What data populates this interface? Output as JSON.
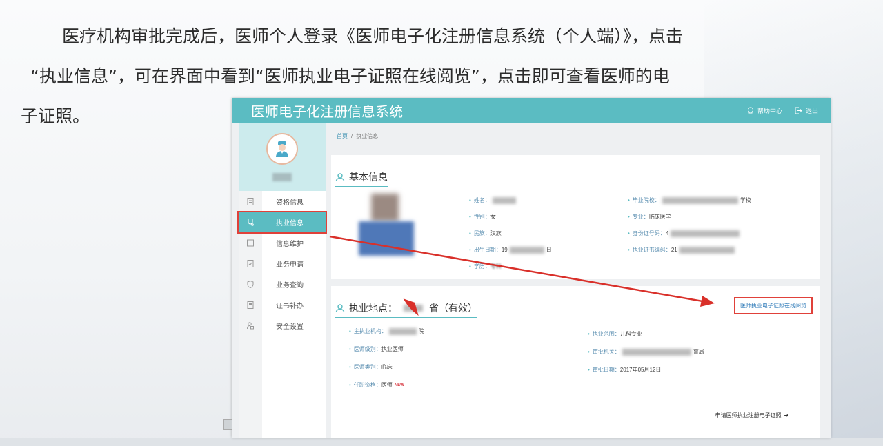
{
  "slide": {
    "line1": "医疗机构审批完成后，医师个人登录《医师电子化注册信息系统（个人端）》，点击",
    "line2": "“执业信息”，可在界面中看到“医师执业电子证照在线阅览”，点击即可查看医师的电",
    "line3": "子证照。"
  },
  "app": {
    "title": "医师电子化注册信息系统",
    "help_label": "帮助中心",
    "logout_label": "退出"
  },
  "sidebar": {
    "items": [
      {
        "label": "资格信息",
        "icon": "document-icon"
      },
      {
        "label": "执业信息",
        "icon": "stethoscope-icon"
      },
      {
        "label": "信息维护",
        "icon": "edit-icon"
      },
      {
        "label": "业务申请",
        "icon": "form-icon"
      },
      {
        "label": "业务查询",
        "icon": "shield-icon"
      },
      {
        "label": "证书补办",
        "icon": "certificate-icon"
      },
      {
        "label": "安全设置",
        "icon": "user-lock-icon"
      }
    ]
  },
  "breadcrumb": {
    "home": "首页",
    "sep": "/",
    "current": "执业信息"
  },
  "basic": {
    "title": "基本信息",
    "name_label": "姓名：",
    "name_value": "",
    "gender_label": "性别：",
    "gender_value": "女",
    "ethnicity_label": "民族：",
    "ethnicity_value": "汉族",
    "birth_label": "出生日期：",
    "birth_prefix": "19",
    "birth_suffix": "日",
    "edu_label": "学历：",
    "edu_value": "专科",
    "school_label": "毕业院校：",
    "school_suffix": "学校",
    "major_label": "专业：",
    "major_value": "临床医学",
    "id_label": "身份证号码：",
    "id_prefix": "4",
    "cert_label": "执业证书编码：",
    "cert_prefix": "21"
  },
  "practice": {
    "title_prefix": "执业地点：",
    "title_suffix": "省（有效）",
    "link_label": "医师执业电子证照在线阅览",
    "inst_label": "主执业机构：",
    "inst_suffix": "院",
    "level_label": "医师级别：",
    "level_value": "执业医师",
    "type_label": "医师类别：",
    "type_value": "临床",
    "title_q_label": "任职资格：",
    "title_q_value": "医师",
    "new_badge": "NEW",
    "scope_label": "执业范围：",
    "scope_value": "儿科专业",
    "authority_label": "审批机关：",
    "authority_suffix": "育局",
    "date_label": "审批日期：",
    "date_value": "2017年05月12日",
    "apply_label": "申请医师执业注册电子证照",
    "apply_arrow": "➔"
  },
  "colors": {
    "accent": "#5bbcc2",
    "highlight": "#e0413a"
  }
}
